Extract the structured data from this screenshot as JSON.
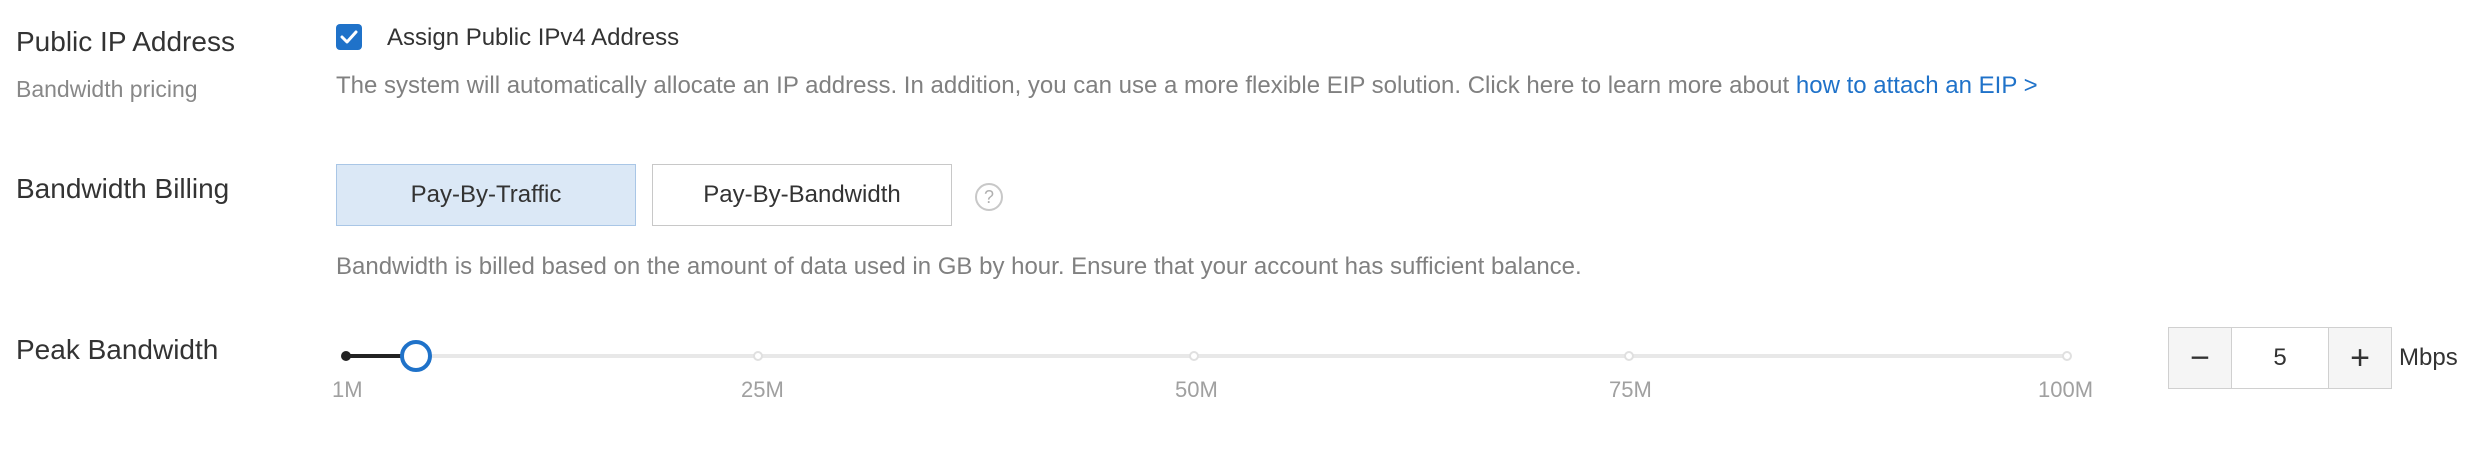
{
  "public_ip": {
    "title": "Public IP Address",
    "subtitle": "Bandwidth pricing",
    "checkbox_label": "Assign Public IPv4 Address",
    "checkbox_checked": true,
    "description": "The system will automatically allocate an IP address. In addition, you can use a more flexible EIP solution. Click here to learn more about ",
    "link_text": "how to attach an EIP >"
  },
  "billing": {
    "title": "Bandwidth Billing",
    "options": [
      "Pay-By-Traffic",
      "Pay-By-Bandwidth"
    ],
    "selected": "Pay-By-Traffic",
    "help_icon": "question-circle-icon",
    "help_glyph": "?",
    "description": "Bandwidth is billed based on the amount of data used in GB by hour. Ensure that your account has sufficient balance."
  },
  "peak": {
    "title": "Peak Bandwidth",
    "ticks": [
      "1M",
      "25M",
      "50M",
      "75M",
      "100M"
    ],
    "value": 5,
    "min": 1,
    "max": 100,
    "value_text": "5",
    "minus_glyph": "−",
    "plus_glyph": "+",
    "unit": "Mbps"
  },
  "colors": {
    "accent": "#1f72c9",
    "selected_bg": "#dbe8f6",
    "muted_text": "#808080"
  }
}
